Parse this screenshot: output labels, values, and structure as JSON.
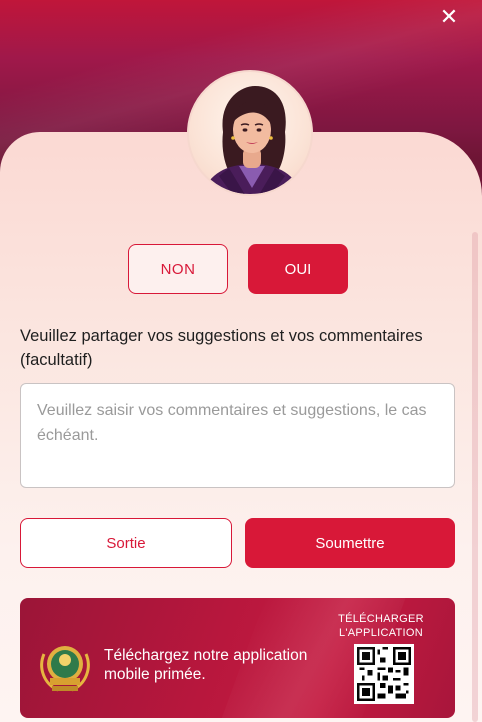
{
  "close": {
    "icon": "close-icon",
    "glyph": "✕"
  },
  "choices": {
    "no_label": "NON",
    "yes_label": "OUI"
  },
  "feedback": {
    "prompt": "Veuillez partager vos suggestions et vos commentaires (facultatif)",
    "placeholder": "Veuillez saisir vos commentaires et suggestions, le cas échéant."
  },
  "actions": {
    "exit_label": "Sortie",
    "submit_label": "Soumettre"
  },
  "banner": {
    "text": "Téléchargez notre application mobile primée.",
    "download_label": "TÉLÉCHARGER L'APPLICATION",
    "award_icon": "award-laurel-icon",
    "qr_icon": "qr-code-icon"
  },
  "colors": {
    "brand_red": "#d81838",
    "header_maroon": "#7d1740",
    "card_pink": "#fbe6e0"
  }
}
